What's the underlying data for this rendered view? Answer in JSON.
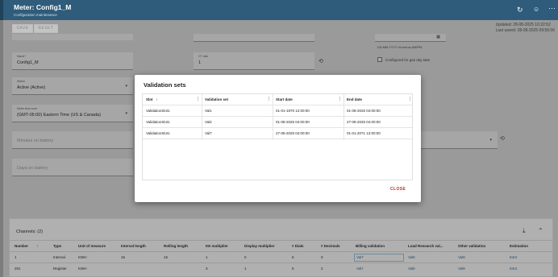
{
  "header": {
    "title": "Meter: Config1_M",
    "subtitle": "Configuration maintenance",
    "icons": [
      "refresh-icon",
      "account-icon",
      "more-icon"
    ]
  },
  "toolbar": {
    "save_label": "SAVE",
    "reset_label": "RESET",
    "updated": "Updated: 28-08-2025 10:22:52",
    "last_saved": "Last saved: 28-08-2025 09:56:06"
  },
  "form": {
    "name": {
      "label": "Name*",
      "value": "Config1_M"
    },
    "ct_ratio": {
      "label": "CT ratio",
      "value": "1"
    },
    "date_hint": "DD-MM-YYYY hh:mm:ss AM/PM",
    "gas_day_label": "Configured for gas day take",
    "status": {
      "label": "Status",
      "value": "Active (Active)"
    },
    "timezone": {
      "label": "Meter time zone",
      "value": "(GMT-05:00) Eastern Time (US & Canada)"
    },
    "minutes_on_battery": "Minutes on battery",
    "days_on_battery": "Days on battery"
  },
  "dialog": {
    "title": "Validation sets",
    "columns": [
      "Slot",
      "Validation set",
      "Start date",
      "End date"
    ],
    "rows": [
      [
        "ValidationSlot1",
        "Val1",
        "01-01-1970 12:00:00",
        "01-08-2025 04:00:00"
      ],
      [
        "ValidationSlot1",
        "Val4",
        "01-08-2025 04:00:00",
        "27-08-2025 04:00:00"
      ],
      [
        "ValidationSlot1",
        "Val7",
        "27-08-2025 04:00:00",
        "01-01-2071 12:00:00"
      ]
    ],
    "close_label": "CLOSE"
  },
  "channels": {
    "title": "Channels: (2)",
    "columns": [
      "Number",
      "Type",
      "Unit of measure",
      "Interval length",
      "Rolling length",
      "KE multiplier",
      "Display multiplier",
      "# Dials",
      "# Decimals",
      "Billing validation",
      "Load Research val...",
      "Other validation",
      "Estimation"
    ],
    "rows": [
      [
        "1",
        "Interval",
        "KWH",
        "15",
        "15",
        "1",
        "0",
        "5",
        "0",
        "Val7",
        "Val8",
        "Val9",
        "Est3"
      ],
      [
        "201",
        "Register",
        "KWH",
        "",
        "",
        "3",
        "1",
        "5",
        "2",
        "Val7",
        "Val8",
        "Val9",
        "Est3"
      ]
    ]
  }
}
